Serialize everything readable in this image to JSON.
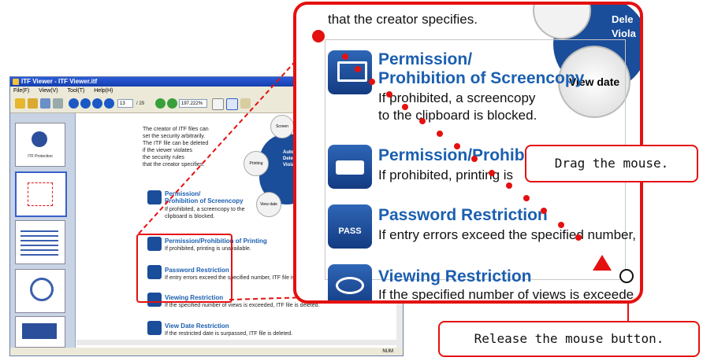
{
  "window": {
    "title": "ITF Viewer - ITF Viewer.itf",
    "menu": [
      "File(F)",
      "View(V)",
      "Tool(T)",
      "Help(H)"
    ],
    "page_current": "13",
    "page_total": "/  29",
    "zoom": "197.222%",
    "status": "NUM"
  },
  "thumbs": [
    {
      "label": "ITF Protection"
    },
    {
      "label": ""
    },
    {
      "label": ""
    },
    {
      "label": ""
    },
    {
      "label": ""
    }
  ],
  "doc": {
    "intro": [
      "The creator of ITF files can",
      "set the security arbitrarily.",
      "The ITF file can be deleted",
      "if the viewer violates",
      "the security rules",
      "that the creator specifies."
    ],
    "wheel": [
      "Screen",
      "Printing",
      "Auto",
      "Delete",
      "Viola",
      "View date"
    ],
    "items": [
      {
        "title": "Permission/\nProhibition of Screencopy",
        "text": "If prohibited, a screencopy to the clipboard is blocked."
      },
      {
        "title": "Permission/Prohibition of Printing",
        "text": "If prohibited, printing is unavailable."
      },
      {
        "title": "Password Restriction",
        "text": "If entry errors exceed the specified number, ITF file is deleted."
      },
      {
        "title": "Viewing Restriction",
        "text": "If the specified number of views is exceeded, ITF file is deleted."
      },
      {
        "title": "View Date Restriction",
        "text": "If the restricted date is surpassed, ITF file is deleted."
      }
    ]
  },
  "zoomed": {
    "top_text": "that the creator specifies.",
    "wheel_top": "Dele",
    "wheel_top2": "Viola",
    "view_date": "View date",
    "item1_title_1": "Permission/",
    "item1_title_2": "Prohibition of Screencopy",
    "item1_text_1": "If prohibited, a screencopy",
    "item1_text_2": "to the clipboard is blocked.",
    "item2_title": "Permission/Prohibiti",
    "item2_text": "If prohibited, printing is",
    "item3_title": "Password Restriction",
    "item3_text": "If entry errors exceed the specified number, I",
    "item4_title": "Viewing Restriction",
    "item4_text": "If the specified number of views is exceede",
    "pass_label": "PASS"
  },
  "callouts": {
    "drag": "Drag the mouse.",
    "release": "Release the mouse button."
  },
  "colors": {
    "accent_red": "#e51010",
    "brand_blue": "#1b5fb0"
  }
}
